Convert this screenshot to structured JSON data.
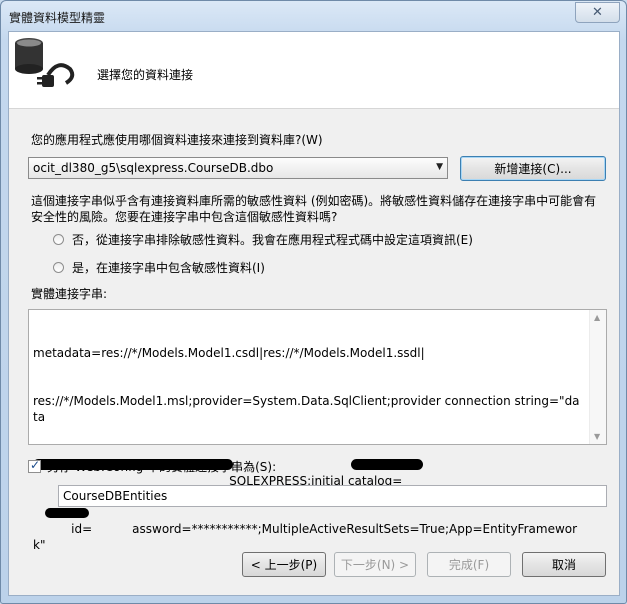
{
  "window": {
    "title": "實體資料模型精靈",
    "close_label": "✕"
  },
  "header": {
    "title": "選擇您的資料連接",
    "icon": "database-plug-icon"
  },
  "connection": {
    "question": "您的應用程式應使用哪個資料連接來連接到資料庫?(W)",
    "selected": "ocit_dl380_g5\\sqlexpress.CourseDB.dbo",
    "new_connection_label": "新增連接(C)..."
  },
  "sensitive": {
    "message": "這個連接字串似乎含有連接資料庫所需的敏感性資料 (例如密碼)。將敏感性資料儲存在連接字串中可能會有安全性的風險。您要在連接字串中包含這個敏感性資料嗎?",
    "option_exclude": "否，從連接字串排除敏感性資料。我會在應用程式程式碼中設定這項資訊(E)",
    "option_include": "是，在連接字串中包含敏感性資料(I)"
  },
  "entity_connection": {
    "label": "實體連接字串:",
    "line1": "metadata=res://*/Models.Model1.csdl|res://*/Models.Model1.ssdl|",
    "line2": "res://*/Models.Model1.msl;provider=System.Data.SqlClient;provider connection string=\"data",
    "line3": "SQLEXPRESS;initial catalog=",
    "line4_prefix": "id=",
    "line4_suffix": "assword=***********;MultipleActiveResultSets=True;App=EntityFramework\""
  },
  "save": {
    "label": "另存 Web.Config 中的實體連接字串為(S):",
    "checked": true,
    "value": "CourseDBEntities"
  },
  "footer": {
    "back_label": "< 上一步(P)",
    "next_label": "下一步(N) >",
    "finish_label": "完成(F)",
    "cancel_label": "取消"
  }
}
